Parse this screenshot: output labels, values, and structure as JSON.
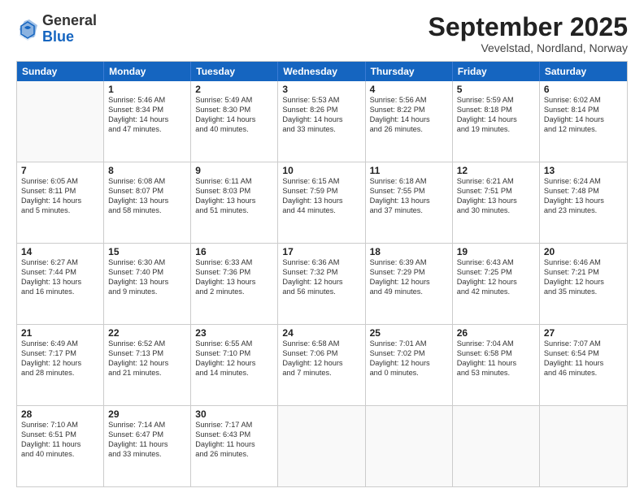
{
  "logo": {
    "general": "General",
    "blue": "Blue"
  },
  "header": {
    "month": "September 2025",
    "location": "Vevelstad, Nordland, Norway"
  },
  "weekdays": [
    "Sunday",
    "Monday",
    "Tuesday",
    "Wednesday",
    "Thursday",
    "Friday",
    "Saturday"
  ],
  "rows": [
    [
      {
        "day": "",
        "lines": []
      },
      {
        "day": "1",
        "lines": [
          "Sunrise: 5:46 AM",
          "Sunset: 8:34 PM",
          "Daylight: 14 hours",
          "and 47 minutes."
        ]
      },
      {
        "day": "2",
        "lines": [
          "Sunrise: 5:49 AM",
          "Sunset: 8:30 PM",
          "Daylight: 14 hours",
          "and 40 minutes."
        ]
      },
      {
        "day": "3",
        "lines": [
          "Sunrise: 5:53 AM",
          "Sunset: 8:26 PM",
          "Daylight: 14 hours",
          "and 33 minutes."
        ]
      },
      {
        "day": "4",
        "lines": [
          "Sunrise: 5:56 AM",
          "Sunset: 8:22 PM",
          "Daylight: 14 hours",
          "and 26 minutes."
        ]
      },
      {
        "day": "5",
        "lines": [
          "Sunrise: 5:59 AM",
          "Sunset: 8:18 PM",
          "Daylight: 14 hours",
          "and 19 minutes."
        ]
      },
      {
        "day": "6",
        "lines": [
          "Sunrise: 6:02 AM",
          "Sunset: 8:14 PM",
          "Daylight: 14 hours",
          "and 12 minutes."
        ]
      }
    ],
    [
      {
        "day": "7",
        "lines": [
          "Sunrise: 6:05 AM",
          "Sunset: 8:11 PM",
          "Daylight: 14 hours",
          "and 5 minutes."
        ]
      },
      {
        "day": "8",
        "lines": [
          "Sunrise: 6:08 AM",
          "Sunset: 8:07 PM",
          "Daylight: 13 hours",
          "and 58 minutes."
        ]
      },
      {
        "day": "9",
        "lines": [
          "Sunrise: 6:11 AM",
          "Sunset: 8:03 PM",
          "Daylight: 13 hours",
          "and 51 minutes."
        ]
      },
      {
        "day": "10",
        "lines": [
          "Sunrise: 6:15 AM",
          "Sunset: 7:59 PM",
          "Daylight: 13 hours",
          "and 44 minutes."
        ]
      },
      {
        "day": "11",
        "lines": [
          "Sunrise: 6:18 AM",
          "Sunset: 7:55 PM",
          "Daylight: 13 hours",
          "and 37 minutes."
        ]
      },
      {
        "day": "12",
        "lines": [
          "Sunrise: 6:21 AM",
          "Sunset: 7:51 PM",
          "Daylight: 13 hours",
          "and 30 minutes."
        ]
      },
      {
        "day": "13",
        "lines": [
          "Sunrise: 6:24 AM",
          "Sunset: 7:48 PM",
          "Daylight: 13 hours",
          "and 23 minutes."
        ]
      }
    ],
    [
      {
        "day": "14",
        "lines": [
          "Sunrise: 6:27 AM",
          "Sunset: 7:44 PM",
          "Daylight: 13 hours",
          "and 16 minutes."
        ]
      },
      {
        "day": "15",
        "lines": [
          "Sunrise: 6:30 AM",
          "Sunset: 7:40 PM",
          "Daylight: 13 hours",
          "and 9 minutes."
        ]
      },
      {
        "day": "16",
        "lines": [
          "Sunrise: 6:33 AM",
          "Sunset: 7:36 PM",
          "Daylight: 13 hours",
          "and 2 minutes."
        ]
      },
      {
        "day": "17",
        "lines": [
          "Sunrise: 6:36 AM",
          "Sunset: 7:32 PM",
          "Daylight: 12 hours",
          "and 56 minutes."
        ]
      },
      {
        "day": "18",
        "lines": [
          "Sunrise: 6:39 AM",
          "Sunset: 7:29 PM",
          "Daylight: 12 hours",
          "and 49 minutes."
        ]
      },
      {
        "day": "19",
        "lines": [
          "Sunrise: 6:43 AM",
          "Sunset: 7:25 PM",
          "Daylight: 12 hours",
          "and 42 minutes."
        ]
      },
      {
        "day": "20",
        "lines": [
          "Sunrise: 6:46 AM",
          "Sunset: 7:21 PM",
          "Daylight: 12 hours",
          "and 35 minutes."
        ]
      }
    ],
    [
      {
        "day": "21",
        "lines": [
          "Sunrise: 6:49 AM",
          "Sunset: 7:17 PM",
          "Daylight: 12 hours",
          "and 28 minutes."
        ]
      },
      {
        "day": "22",
        "lines": [
          "Sunrise: 6:52 AM",
          "Sunset: 7:13 PM",
          "Daylight: 12 hours",
          "and 21 minutes."
        ]
      },
      {
        "day": "23",
        "lines": [
          "Sunrise: 6:55 AM",
          "Sunset: 7:10 PM",
          "Daylight: 12 hours",
          "and 14 minutes."
        ]
      },
      {
        "day": "24",
        "lines": [
          "Sunrise: 6:58 AM",
          "Sunset: 7:06 PM",
          "Daylight: 12 hours",
          "and 7 minutes."
        ]
      },
      {
        "day": "25",
        "lines": [
          "Sunrise: 7:01 AM",
          "Sunset: 7:02 PM",
          "Daylight: 12 hours",
          "and 0 minutes."
        ]
      },
      {
        "day": "26",
        "lines": [
          "Sunrise: 7:04 AM",
          "Sunset: 6:58 PM",
          "Daylight: 11 hours",
          "and 53 minutes."
        ]
      },
      {
        "day": "27",
        "lines": [
          "Sunrise: 7:07 AM",
          "Sunset: 6:54 PM",
          "Daylight: 11 hours",
          "and 46 minutes."
        ]
      }
    ],
    [
      {
        "day": "28",
        "lines": [
          "Sunrise: 7:10 AM",
          "Sunset: 6:51 PM",
          "Daylight: 11 hours",
          "and 40 minutes."
        ]
      },
      {
        "day": "29",
        "lines": [
          "Sunrise: 7:14 AM",
          "Sunset: 6:47 PM",
          "Daylight: 11 hours",
          "and 33 minutes."
        ]
      },
      {
        "day": "30",
        "lines": [
          "Sunrise: 7:17 AM",
          "Sunset: 6:43 PM",
          "Daylight: 11 hours",
          "and 26 minutes."
        ]
      },
      {
        "day": "",
        "lines": []
      },
      {
        "day": "",
        "lines": []
      },
      {
        "day": "",
        "lines": []
      },
      {
        "day": "",
        "lines": []
      }
    ]
  ]
}
